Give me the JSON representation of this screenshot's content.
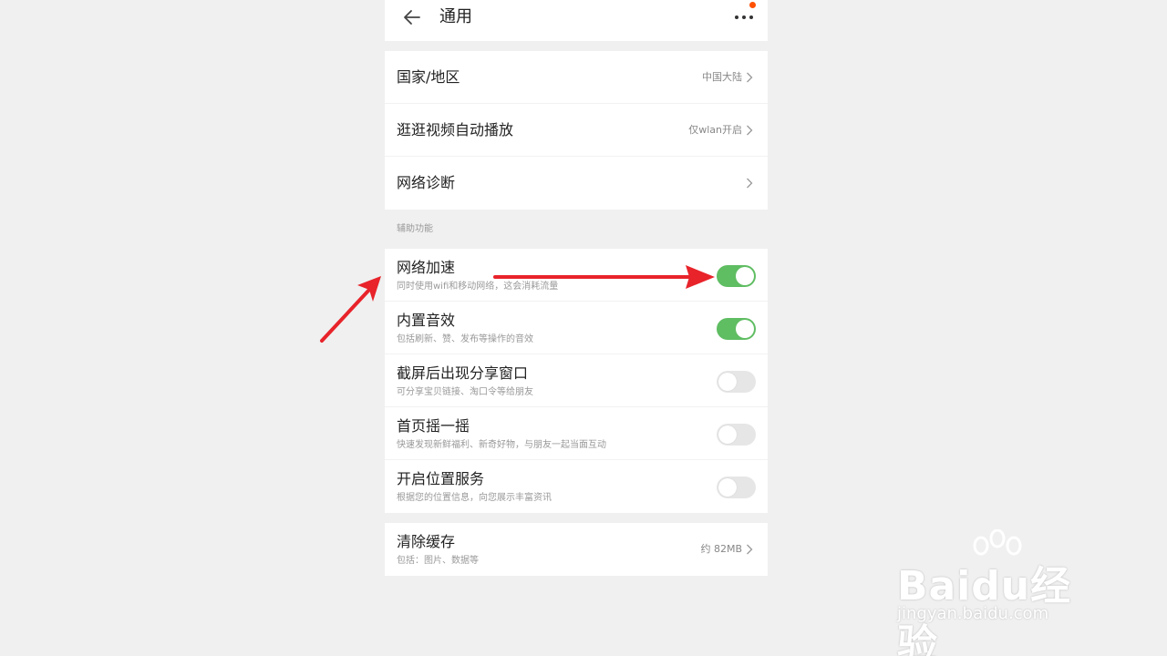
{
  "header": {
    "title": "通用"
  },
  "group1": [
    {
      "title": "国家/地区",
      "value": "中国大陆"
    },
    {
      "title": "逛逛视频自动播放",
      "value": "仅wlan开启"
    },
    {
      "title": "网络诊断",
      "value": ""
    }
  ],
  "section_label": "辅助功能",
  "group2": [
    {
      "title": "网络加速",
      "subtitle": "同时使用wifi和移动网络，这会消耗流量",
      "enabled": true
    },
    {
      "title": "内置音效",
      "subtitle": "包括刷新、赞、发布等操作的音效",
      "enabled": true
    },
    {
      "title": "截屏后出现分享窗口",
      "subtitle": "可分享宝贝链接、淘口令等给朋友",
      "enabled": false
    },
    {
      "title": "首页摇一摇",
      "subtitle": "快速发现新鲜福利、新奇好物，与朋友一起当面互动",
      "enabled": false
    },
    {
      "title": "开启位置服务",
      "subtitle": "根据您的位置信息，向您展示丰富资讯",
      "enabled": false
    }
  ],
  "group3": [
    {
      "title": "清除缓存",
      "subtitle": "包括：图片、数据等",
      "value": "约 82MB"
    }
  ],
  "watermark": {
    "logo": "Baidu经验",
    "url": "jingyan.baidu.com"
  },
  "colors": {
    "toggle_on": "#5fbd62",
    "toggle_off": "#e6e6e6",
    "annotation_arrow": "#e8232a",
    "notify_dot": "#ff5000"
  }
}
